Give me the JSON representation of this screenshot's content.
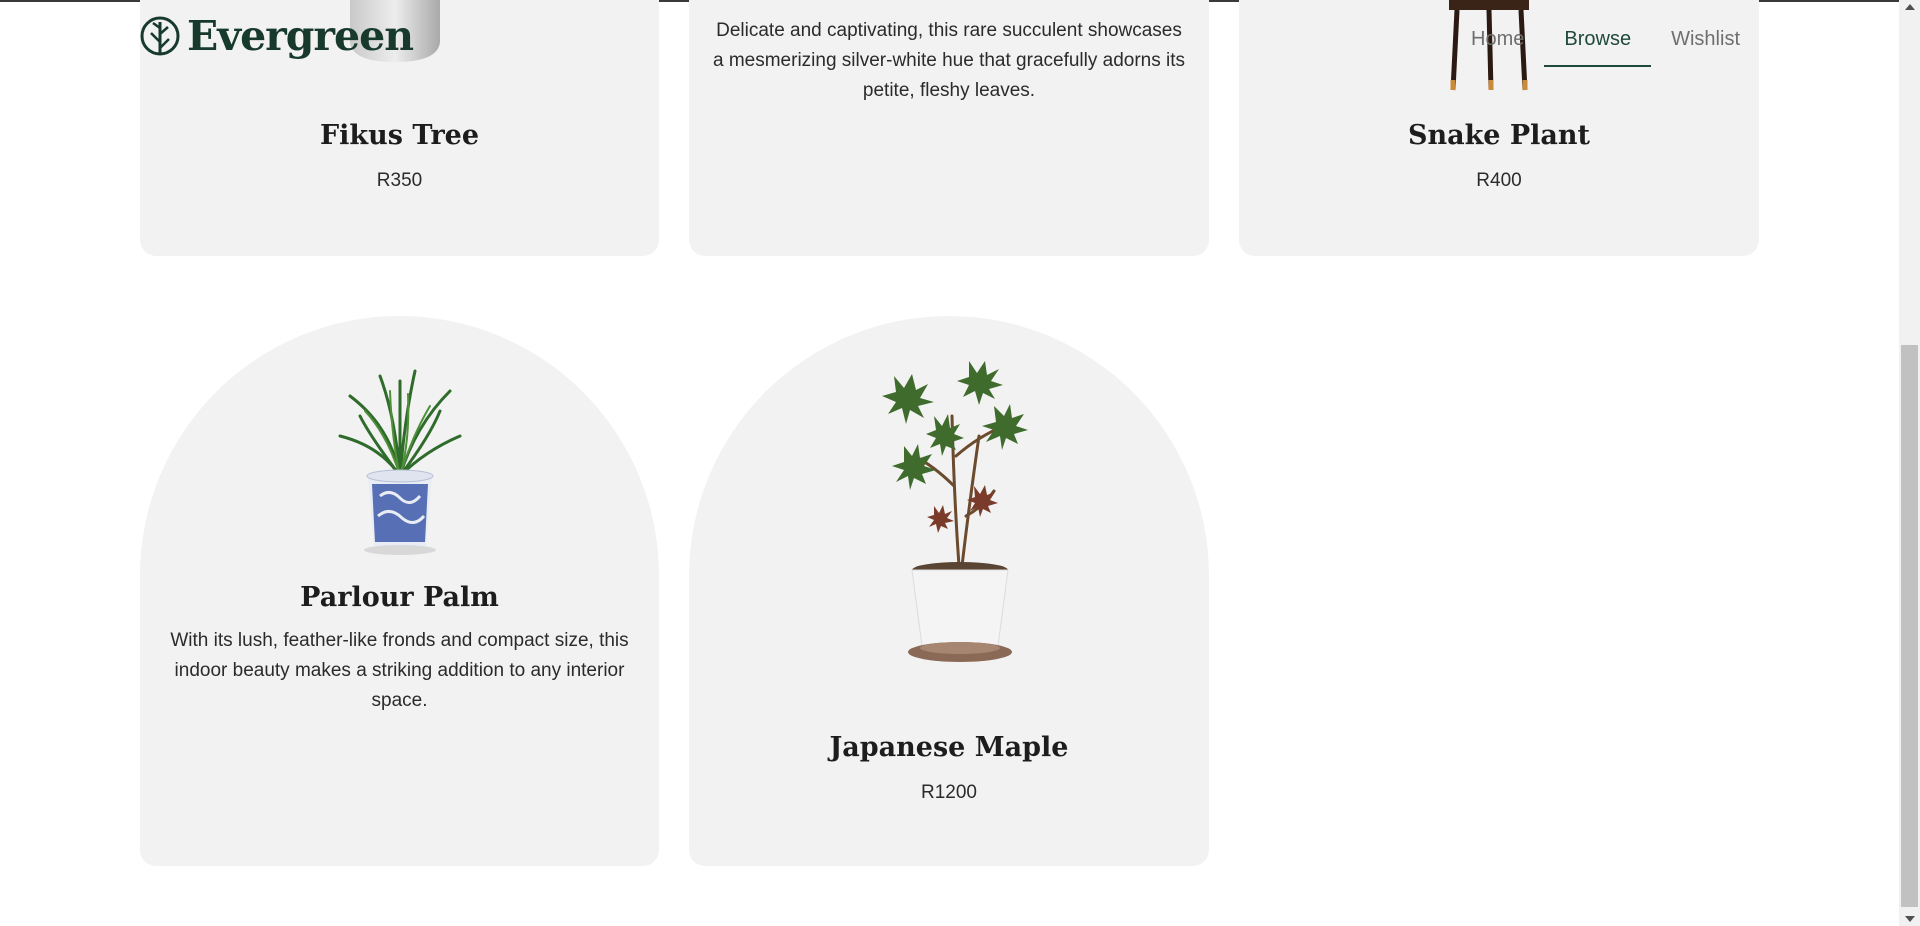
{
  "brand": {
    "name": "Evergreen",
    "logo_icon": "leaf-icon"
  },
  "nav": [
    {
      "label": "Home",
      "active": false
    },
    {
      "label": "Browse",
      "active": true
    },
    {
      "label": "Wishlist",
      "active": false
    }
  ],
  "products": [
    {
      "name": "Fikus Tree",
      "price": "R350"
    },
    {
      "description": "Delicate and captivating, this rare succulent showcases a mesmerizing silver-white hue that gracefully adorns its petite, fleshy leaves."
    },
    {
      "name": "Snake Plant",
      "price": "R400"
    },
    {
      "name": "Parlour Palm",
      "description": "With its lush, feather-like fronds and compact size, this indoor beauty makes a striking addition to any interior space."
    },
    {
      "name": "Japanese Maple",
      "price": "R1200"
    }
  ],
  "colors": {
    "brand": "#173a2c",
    "card_bg": "#f2f2f2",
    "nav_active": "#1f4a3a"
  }
}
